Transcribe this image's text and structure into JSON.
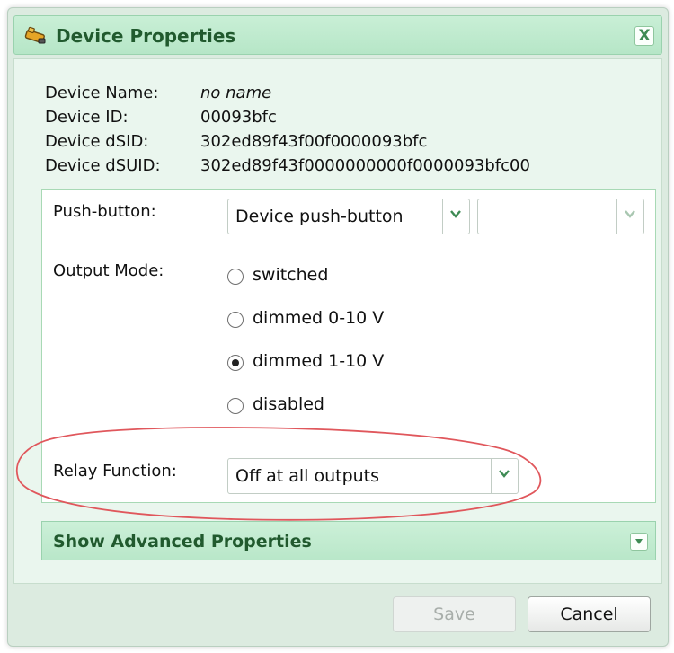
{
  "dialog": {
    "title": "Device Properties",
    "close_label": "X"
  },
  "device_info": [
    {
      "label": "Device Name:",
      "value": "no name"
    },
    {
      "label": "Device ID:",
      "value": "00093bfc"
    },
    {
      "label": "Device dSID:",
      "value": "302ed89f43f00f0000093bfc"
    },
    {
      "label": "Device dSUID:",
      "value": "302ed89f43f0000000000f0000093bfc00"
    }
  ],
  "push_button": {
    "label": "Push-button:",
    "selected": "Device push-button",
    "secondary_selected": ""
  },
  "output_mode": {
    "label": "Output Mode:",
    "options": [
      "switched",
      "dimmed 0-10 V",
      "dimmed 1-10 V",
      "disabled"
    ],
    "selected_index": 2
  },
  "relay_function": {
    "label": "Relay Function:",
    "selected": "Off at all outputs"
  },
  "advanced": {
    "label": "Show Advanced Properties"
  },
  "footer": {
    "save_label": "Save",
    "cancel_label": "Cancel"
  },
  "colors": {
    "title_text": "#215a2e",
    "panel_border": "#a8d9b5",
    "annotation": "#e0575c"
  },
  "icons": {
    "title": "device-plug-icon",
    "close": "close-icon",
    "dropdown": "chevron-down-icon",
    "expand": "chevron-down-icon"
  }
}
